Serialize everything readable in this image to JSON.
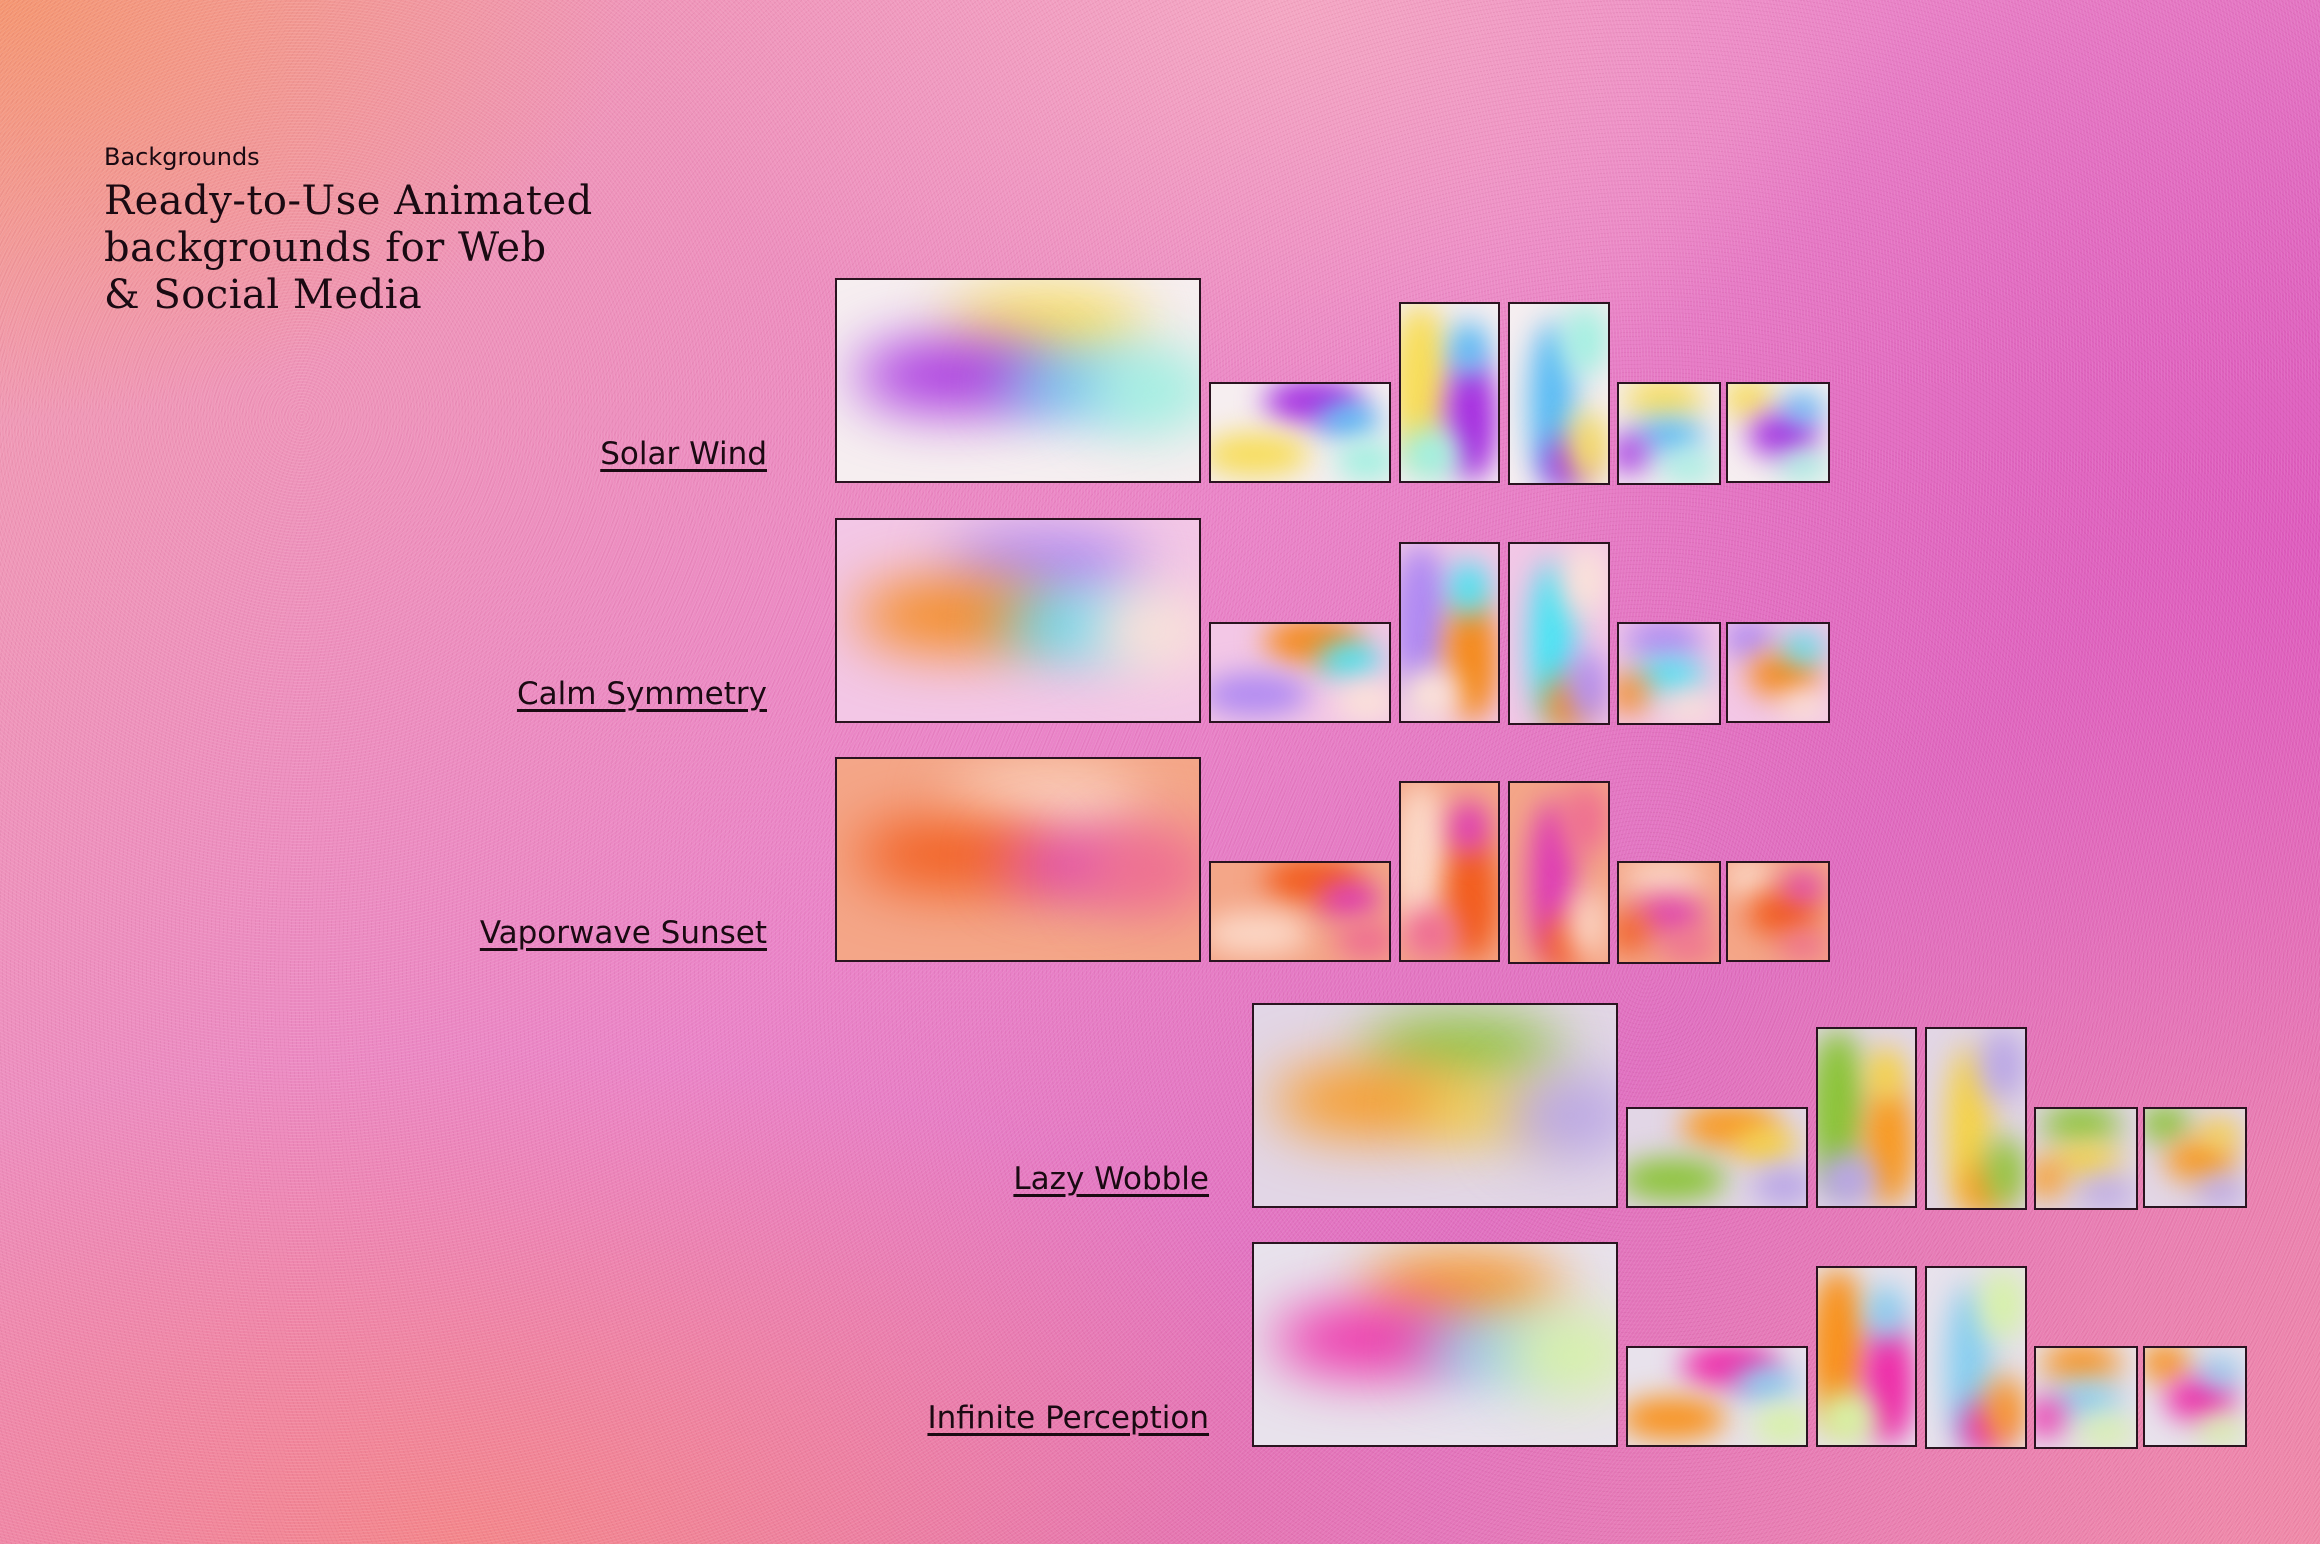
{
  "header": {
    "eyebrow": "Backgrounds",
    "title_lines": [
      "Ready-to-Use Animated",
      "backgrounds for Web",
      "& Social Media"
    ]
  },
  "collections": [
    {
      "name": "Solar Wind",
      "palette": {
        "base": "#f6eef0",
        "c1": "#a52de0",
        "c2": "#4fb8f5",
        "c3": "#f7dd5a",
        "c4": "#9ff0e0"
      },
      "thumbnails": [
        "landscape-large",
        "landscape",
        "portrait",
        "portrait",
        "square",
        "square"
      ]
    },
    {
      "name": "Calm Symmetry",
      "palette": {
        "base": "#f3c7e6",
        "c1": "#f48a1a",
        "c2": "#3fe6f4",
        "c3": "#b08af2",
        "c4": "#fbe3d8"
      },
      "thumbnails": [
        "landscape-large",
        "landscape",
        "portrait",
        "portrait",
        "square",
        "square"
      ]
    },
    {
      "name": "Vaporwave Sunset",
      "palette": {
        "base": "#f4a688",
        "c1": "#f25c1c",
        "c2": "#dc36b8",
        "c3": "#fbd7c6",
        "c4": "#ee6c92"
      },
      "thumbnails": [
        "landscape-large",
        "landscape",
        "portrait",
        "portrait",
        "square",
        "square"
      ]
    },
    {
      "name": "Lazy Wobble",
      "palette": {
        "base": "#e2d6e6",
        "c1": "#f89a22",
        "c2": "#f6d23e",
        "c3": "#8cc43a",
        "c4": "#b8a4e6"
      },
      "thumbnails": [
        "landscape-large",
        "landscape",
        "portrait",
        "portrait",
        "square",
        "square"
      ]
    },
    {
      "name": "Infinite Perception",
      "palette": {
        "base": "#e8e2ec",
        "c1": "#ee2aa8",
        "c2": "#82cdf0",
        "c3": "#f8921e",
        "c4": "#d6f2a4"
      },
      "thumbnails": [
        "landscape-large",
        "landscape",
        "portrait",
        "portrait",
        "square",
        "square"
      ]
    }
  ]
}
